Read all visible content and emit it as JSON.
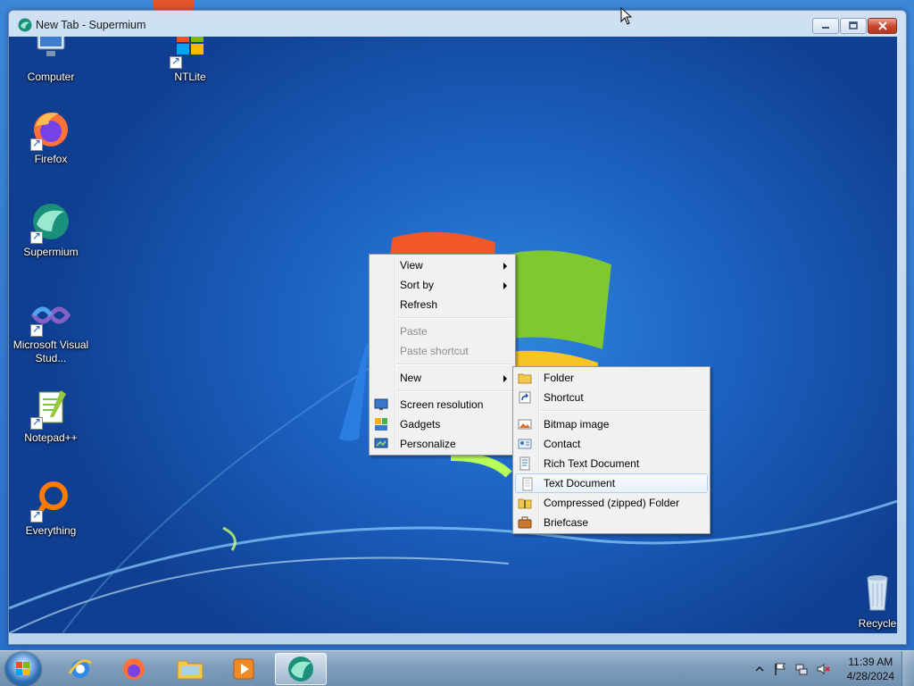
{
  "window": {
    "title": "New Tab - Supermium",
    "minimize_icon": "minimize-icon",
    "maximize_icon": "maximize-icon",
    "close_icon": "close-icon"
  },
  "desktop_icons": [
    {
      "label": "Computer",
      "icon": "computer-icon"
    },
    {
      "label": "NTLite",
      "icon": "ntlite-icon"
    },
    {
      "label": "Firefox",
      "icon": "firefox-icon"
    },
    {
      "label": "Supermium",
      "icon": "supermium-icon"
    },
    {
      "label": "Microsoft Visual Stud...",
      "icon": "visual-studio-icon"
    },
    {
      "label": "Notepad++",
      "icon": "notepadpp-icon"
    },
    {
      "label": "Everything",
      "icon": "everything-icon"
    },
    {
      "label": "Recycle",
      "icon": "recycle-bin-icon"
    }
  ],
  "context_menu": {
    "items": [
      {
        "label": "View",
        "submenu": true
      },
      {
        "label": "Sort by",
        "submenu": true
      },
      {
        "label": "Refresh"
      },
      {
        "label": "Paste",
        "disabled": true
      },
      {
        "label": "Paste shortcut",
        "disabled": true
      },
      {
        "label": "New",
        "submenu": true
      },
      {
        "label": "Screen resolution",
        "icon": "screen-resolution-icon"
      },
      {
        "label": "Gadgets",
        "icon": "gadgets-icon"
      },
      {
        "label": "Personalize",
        "icon": "personalize-icon"
      }
    ]
  },
  "new_submenu": {
    "items": [
      {
        "label": "Folder",
        "icon": "folder-icon"
      },
      {
        "label": "Shortcut",
        "icon": "shortcut-icon"
      },
      {
        "label": "Bitmap image",
        "icon": "bitmap-icon"
      },
      {
        "label": "Contact",
        "icon": "contact-icon"
      },
      {
        "label": "Rich Text Document",
        "icon": "rich-text-icon"
      },
      {
        "label": "Text Document",
        "icon": "text-document-icon",
        "highlighted": true
      },
      {
        "label": "Compressed (zipped) Folder",
        "icon": "zip-folder-icon"
      },
      {
        "label": "Briefcase",
        "icon": "briefcase-icon"
      }
    ]
  },
  "taskbar": {
    "apps": [
      {
        "name": "internet-explorer",
        "icon": "internet-explorer-icon"
      },
      {
        "name": "firefox",
        "icon": "firefox-icon"
      },
      {
        "name": "file-explorer",
        "icon": "folder-icon"
      },
      {
        "name": "media-player",
        "icon": "media-player-icon"
      },
      {
        "name": "supermium",
        "icon": "supermium-icon",
        "active": true
      }
    ],
    "clock": {
      "time": "11:39 AM",
      "date": "4/28/2024"
    },
    "tray_icons": [
      "show-hidden-icons-icon",
      "action-center-flag-icon",
      "network-icon",
      "volume-muted-icon"
    ]
  },
  "colors": {
    "desktop_blue": "#1d63c4",
    "menu_bg": "#f1f1f1",
    "highlight_border": "#aecff7"
  }
}
